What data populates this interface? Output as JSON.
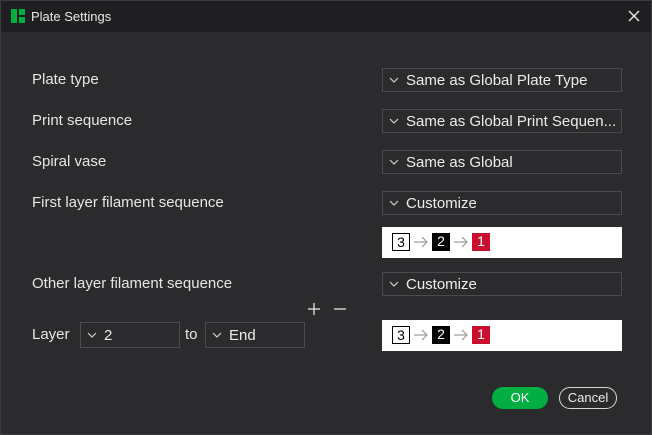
{
  "window": {
    "title": "Plate Settings",
    "app_icon": "bambu-studio-icon",
    "close_icon": "close-icon"
  },
  "rows": {
    "plate_type": {
      "label": "Plate type",
      "value": "Same as Global Plate Type"
    },
    "print_sequence": {
      "label": "Print sequence",
      "value": "Same as Global Print Sequen..."
    },
    "spiral_vase": {
      "label": "Spiral vase",
      "value": "Same as Global"
    },
    "first_layer": {
      "label": "First layer filament sequence",
      "value": "Customize"
    },
    "other_layer": {
      "label": "Other layer filament sequence",
      "value": "Customize"
    }
  },
  "first_layer_sequence": [
    "3",
    "2",
    "1"
  ],
  "other_layer_sequence": [
    "3",
    "2",
    "1"
  ],
  "layer_range": {
    "label": "Layer",
    "from": "2",
    "to_label": "to",
    "to": "End"
  },
  "buttons": {
    "ok": "OK",
    "cancel": "Cancel"
  },
  "colors": {
    "accent": "#00ae42",
    "chip_red": "#c8102e",
    "chip_black": "#000000"
  }
}
